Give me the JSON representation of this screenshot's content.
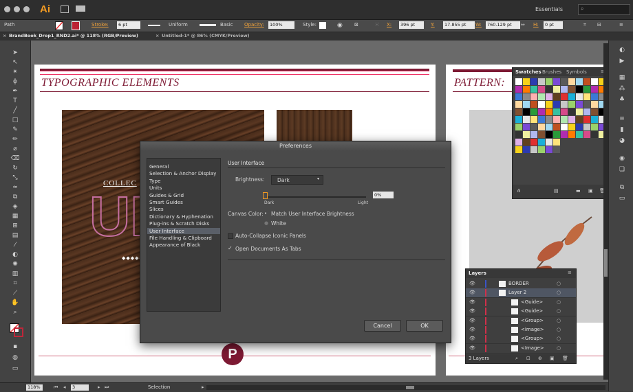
{
  "app": {
    "logo": "Ai",
    "workspace": "Essentials"
  },
  "control_bar": {
    "object_type": "Path",
    "stroke_label": "Stroke:",
    "stroke_value": "6 pt",
    "profile_label": "Uniform",
    "brush_label": "Basic",
    "opacity_label": "Opacity:",
    "opacity_value": "100%",
    "style_label": "Style:",
    "x_label": "X:",
    "x_value": "396 pt",
    "y_label": "Y:",
    "y_value": "17.855 pt",
    "w_label": "W:",
    "w_value": "760.129 pt",
    "h_label": "H:",
    "h_value": "0 pt"
  },
  "tabs": [
    {
      "label": "BrandBook_Drop1_RND2.ai* @ 118% (RGB/Preview)"
    },
    {
      "label": "Untitled-1* @ 86% (CMYK/Preview)"
    }
  ],
  "artboard": {
    "heading1": "TYPOGRAPHIC ELEMENTS",
    "heading2": "PATTERN:",
    "collection_text": "COLLEC",
    "big_letters": "UN",
    "logo_letter": "P"
  },
  "preferences": {
    "title": "Preferences",
    "categories": [
      "General",
      "Selection & Anchor Display",
      "Type",
      "Units",
      "Guides & Grid",
      "Smart Guides",
      "Slices",
      "Dictionary & Hyphenation",
      "Plug-ins & Scratch Disks",
      "User Interface",
      "File Handling & Clipboard",
      "Appearance of Black"
    ],
    "selected_index": 9,
    "section_title": "User Interface",
    "brightness_label": "Brightness:",
    "brightness_value": "Dark",
    "slider_value": "0%",
    "slider_min_label": "Dark",
    "slider_max_label": "Light",
    "canvas_color_label": "Canvas Color:",
    "canvas_option_1": "Match User Interface Brightness",
    "canvas_option_2": "White",
    "auto_collapse_label": "Auto-Collapse Iconic Panels",
    "open_as_tabs_label": "Open Documents As Tabs",
    "cancel_label": "Cancel",
    "ok_label": "OK"
  },
  "swatches_panel": {
    "tabs": [
      "Swatches",
      "Brushes",
      "Symbols"
    ]
  },
  "layers_panel": {
    "title": "Layers",
    "rows": [
      {
        "name": "BORDER"
      },
      {
        "name": "Layer 2"
      },
      {
        "name": "<Guide>"
      },
      {
        "name": "<Guide>"
      },
      {
        "name": "<Group>"
      },
      {
        "name": "<Image>"
      },
      {
        "name": "<Group>"
      },
      {
        "name": "<Image>"
      }
    ],
    "footer": "3 Layers"
  },
  "status_bar": {
    "zoom": "118%",
    "artboard_number": "3",
    "tool": "Selection"
  },
  "colors": {
    "accent": "#f39b22",
    "heading": "#7d1933",
    "guide": "#d0667a"
  }
}
